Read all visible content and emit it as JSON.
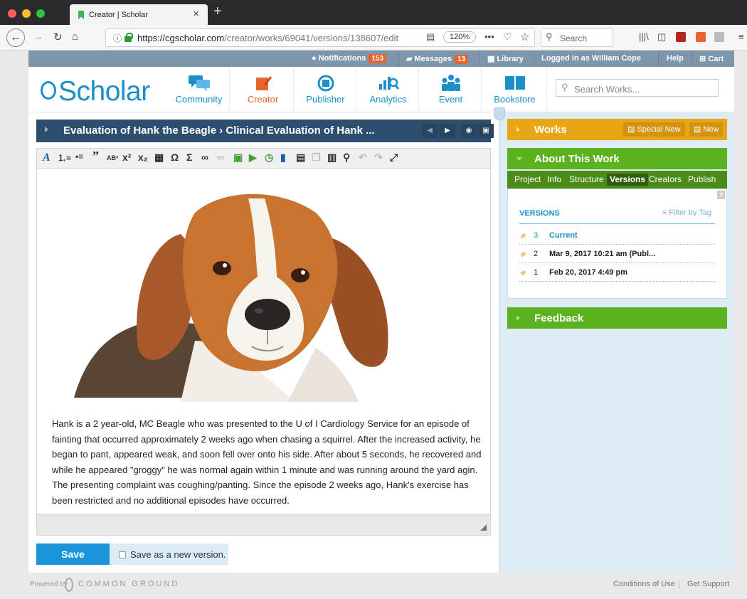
{
  "browser": {
    "tab_title": "Creator | Scholar",
    "url_base": "https://cgscholar.com",
    "url_path": "/creator/works/69041/versions/138607/edit",
    "zoom": "120%",
    "search_placeholder": "Search"
  },
  "topbar": {
    "notifications_label": "Notifications",
    "notifications_count": "153",
    "messages_label": "Messages",
    "messages_count": "13",
    "library_label": "Library",
    "logged_in": "Logged in as William Cope",
    "help": "Help",
    "cart": "Cart"
  },
  "logo": "Scholar",
  "nav": {
    "community": "Community",
    "creator": "Creator",
    "publisher": "Publisher",
    "analytics": "Analytics",
    "event": "Event",
    "bookstore": "Bookstore"
  },
  "search_works_placeholder": "Search Works...",
  "doc_title": "Evaluation of Hank the Beagle › Clinical Evaluation of Hank ...",
  "body_text": "Hank is a 2 year-old, MC Beagle who was presented to the U of I Cardiology Service for an episode of fainting that occurred approximately 2 weeks ago when chasing a squirrel. After the increased activity, he began to pant, appeared weak, and soon fell over onto his side. After about 5 seconds, he recovered and while he appeared \"groggy\" he was normal again within 1 minute and was running around the yard agin. The presenting complaint was coughing/panting. Since the episode 2 weeks ago, Hank's exercise has been restricted and no additional episodes have occurred.",
  "save": {
    "button": "Save",
    "checkbox_label": "Save as a new version."
  },
  "works_panel": {
    "title": "Works",
    "special_new": "Special New",
    "new": "New"
  },
  "about_panel": {
    "title": "About This Work",
    "tabs": [
      "Project",
      "Info",
      "Structure",
      "Versions",
      "Creators",
      "Publish"
    ],
    "active_tab": "Versions",
    "help": "?"
  },
  "versions": {
    "heading": "VERSIONS",
    "filter": "Filter by Tag",
    "items": [
      {
        "num": "3",
        "label": "Current"
      },
      {
        "num": "2",
        "label": "Mar 9, 2017 10:21 am (Publ..."
      },
      {
        "num": "1",
        "label": "Feb 20, 2017 4:49 pm"
      }
    ]
  },
  "feedback_title": "Feedback",
  "footer": {
    "powered_by": "Powered by",
    "common_ground": "COMMON GROUND",
    "conditions": "Conditions of Use",
    "support": "Get Support"
  },
  "colors": {
    "brand_blue": "#1a8fc9",
    "creator_orange": "#e8642d",
    "works_yellow": "#e8a615",
    "about_green": "#5bb11e",
    "doc_bar_navy": "#2e4e70"
  }
}
